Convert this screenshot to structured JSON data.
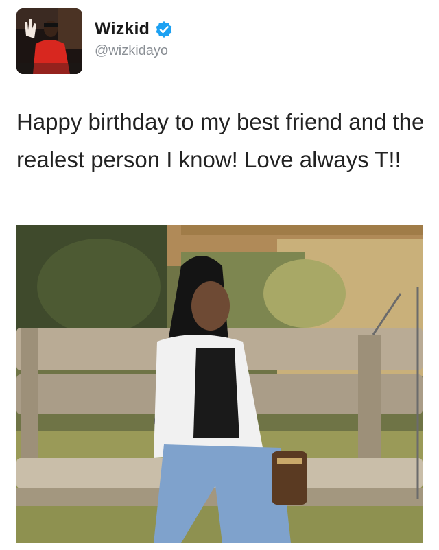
{
  "user": {
    "display_name": "Wizkid",
    "handle": "@wizkidayo",
    "verified_icon": "verified-check-icon",
    "avatar": "profile-photo"
  },
  "tweet": {
    "text": "Happy birthday to my best friend and the realest person I know! Love always T!!"
  },
  "media": {
    "kind": "photo",
    "description_icon": "photo-woman-on-wooden-swing"
  },
  "colors": {
    "verified_blue": "#1da1f2",
    "handle_gray": "#8a8f95",
    "text": "#222222"
  }
}
